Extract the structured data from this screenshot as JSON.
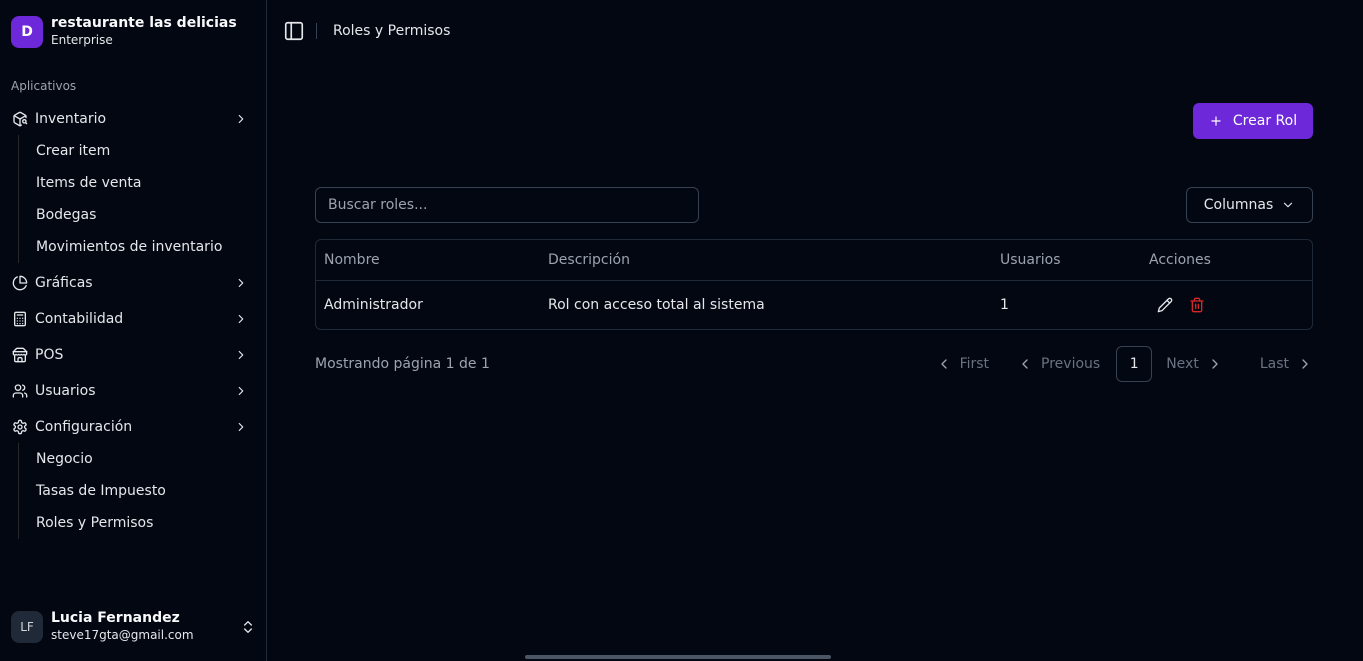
{
  "brand": {
    "initial": "D",
    "name": "restaurante las delicias",
    "plan": "Enterprise"
  },
  "sidebar": {
    "group_label": "Aplicativos",
    "items": [
      {
        "label": "Inventario",
        "icon": "package-search-icon",
        "children": [
          "Crear item",
          "Items de venta",
          "Bodegas",
          "Movimientos de inventario"
        ]
      },
      {
        "label": "Gráficas",
        "icon": "pie-chart-icon"
      },
      {
        "label": "Contabilidad",
        "icon": "calculator-icon"
      },
      {
        "label": "POS",
        "icon": "store-icon"
      },
      {
        "label": "Usuarios",
        "icon": "users-icon"
      },
      {
        "label": "Configuración",
        "icon": "gear-icon",
        "children": [
          "Negocio",
          "Tasas de Impuesto",
          "Roles y Permisos"
        ]
      }
    ]
  },
  "user": {
    "initials": "LF",
    "name": "Lucia Fernandez",
    "email": "steve17gta@gmail.com"
  },
  "header": {
    "breadcrumb": "Roles y Permisos"
  },
  "toolbar": {
    "create_label": "Crear Rol",
    "search_placeholder": "Buscar roles...",
    "columns_label": "Columnas"
  },
  "table": {
    "headers": [
      "Nombre",
      "Descripción",
      "Usuarios",
      "Acciones"
    ],
    "rows": [
      {
        "name": "Administrador",
        "description": "Rol con acceso total al sistema",
        "users": "1"
      }
    ]
  },
  "pagination": {
    "info": "Mostrando página 1 de 1",
    "first": "First",
    "previous": "Previous",
    "current": "1",
    "next": "Next",
    "last": "Last"
  },
  "colors": {
    "accent": "#6d28d9",
    "danger": "#dc2626",
    "background": "#030712"
  }
}
